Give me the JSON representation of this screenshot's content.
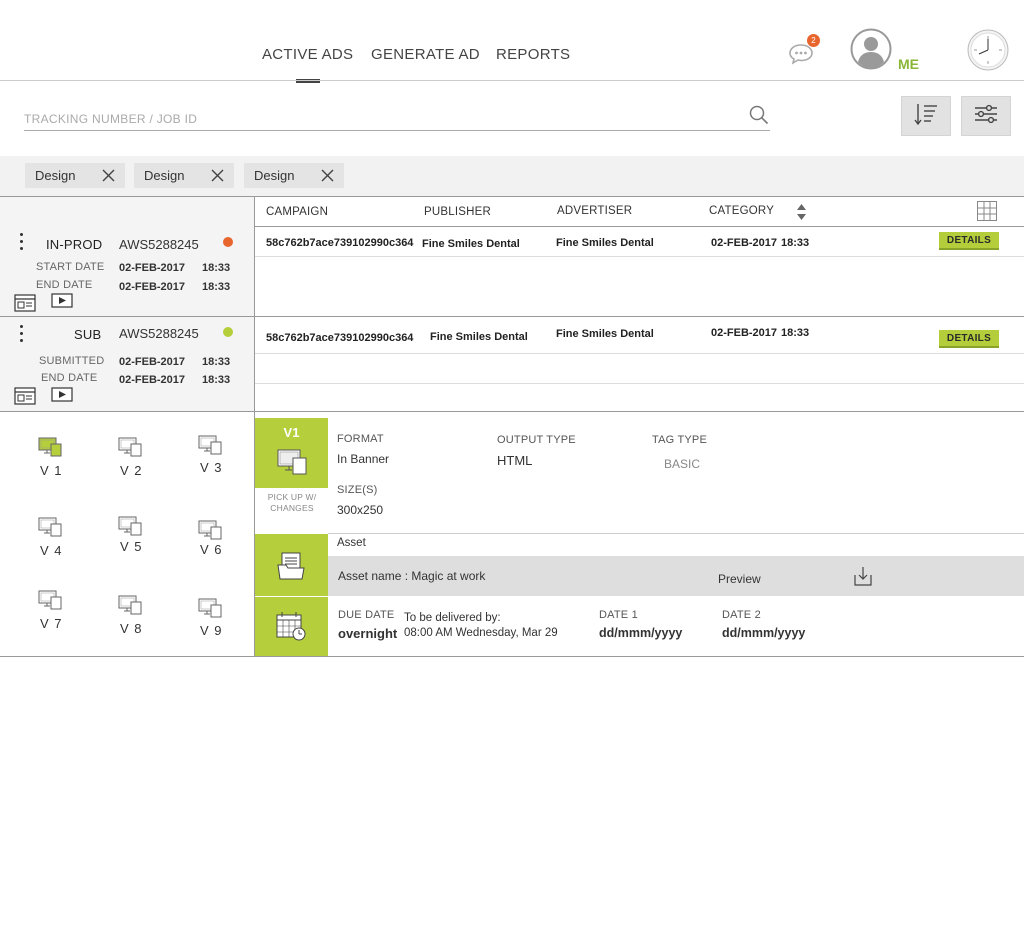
{
  "nav": {
    "tabs": [
      {
        "label": "ACTIVE ADS",
        "active": true
      },
      {
        "label": "GENERATE AD",
        "active": false
      },
      {
        "label": "REPORTS",
        "active": false
      }
    ]
  },
  "header": {
    "chat_badge_count": "2",
    "user_label": "ME",
    "icons": [
      "chat-icon",
      "user-avatar-icon",
      "clock-icon"
    ]
  },
  "search": {
    "placeholder": "TRACKING NUMBER / JOB ID",
    "value": ""
  },
  "filters": {
    "chips": [
      "Design",
      "Design",
      "Design"
    ]
  },
  "table": {
    "columns": [
      "CAMPAIGN",
      "PUBLISHER",
      "ADVERTISER",
      "CATEGORY"
    ],
    "rows": [
      {
        "status": "IN-PROD",
        "status_color": "#e8662e",
        "job_id": "AWS5288245",
        "label1": "START DATE",
        "date1": "02-FEB-2017",
        "time1": "18:33",
        "label2": "END DATE",
        "date2": "02-FEB-2017",
        "time2": "18:33",
        "campaign": "58c762b7ace739102990c364",
        "publisher": "Fine Smiles Dental",
        "advertiser": "Fine Smiles Dental",
        "category_date": "02-FEB-2017",
        "category_time": "18:33",
        "details_label": "DETAILS"
      },
      {
        "status": "SUB",
        "status_color": "#b5cf3c",
        "job_id": "AWS5288245",
        "label1": "SUBMITTED",
        "date1": "02-FEB-2017",
        "time1": "18:33",
        "label2": "END DATE",
        "date2": "02-FEB-2017",
        "time2": "18:33",
        "campaign": "58c762b7ace739102990c364",
        "publisher": "Fine Smiles Dental",
        "advertiser": "Fine Smiles Dental",
        "category_date": "02-FEB-2017",
        "category_time": "18:33",
        "details_label": "DETAILS"
      }
    ]
  },
  "versions": {
    "items": [
      "V 1",
      "V 2",
      "V 3",
      "V 4",
      "V 5",
      "V 6",
      "V 7",
      "V 8",
      "V 9"
    ],
    "selected_index": 0
  },
  "detail": {
    "version_label": "V1",
    "pickup_label": "PICK UP W/ CHANGES",
    "format_label": "FORMAT",
    "format_value": "In Banner",
    "output_label": "OUTPUT TYPE",
    "output_value": "HTML",
    "tag_label": "TAG TYPE",
    "tag_value": "BASIC",
    "size_label": "SIZE(S)",
    "size_value": "300x250",
    "asset_heading": "Asset",
    "asset_name": "Asset  name : Magic at work",
    "preview_label": "Preview",
    "due_label": "DUE DATE",
    "due_value": "overnight",
    "delivered_label": "To be delivered by:",
    "delivered_value": "08:00 AM Wednesday, Mar 29",
    "date1_label": "DATE 1",
    "date1_value": "dd/mmm/yyyy",
    "date2_label": "DATE 2",
    "date2_value": "dd/mmm/yyyy"
  },
  "colors": {
    "accent_green": "#b5cf3c",
    "status_orange": "#e8662e",
    "me_green": "#8ab637"
  }
}
